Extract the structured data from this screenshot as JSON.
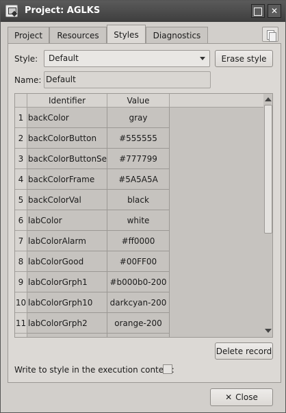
{
  "window": {
    "title": "Project: AGLKS"
  },
  "tabs": [
    {
      "label": "Project",
      "active": false
    },
    {
      "label": "Resources",
      "active": false
    },
    {
      "label": "Styles",
      "active": true
    },
    {
      "label": "Diagnostics",
      "active": false
    }
  ],
  "style_row": {
    "label": "Style:",
    "selected": "Default",
    "erase_label": "Erase style"
  },
  "name_row": {
    "label": "Name:",
    "value": "Default"
  },
  "table": {
    "headers": [
      "Identifier",
      "Value"
    ],
    "rows": [
      {
        "num": "1",
        "id": "backColor",
        "value": "gray"
      },
      {
        "num": "2",
        "id": "backColorButton",
        "value": "#555555"
      },
      {
        "num": "3",
        "id": "backColorButtonSel",
        "value": "#777799"
      },
      {
        "num": "4",
        "id": "backColorFrame",
        "value": "#5A5A5A"
      },
      {
        "num": "5",
        "id": "backColorVal",
        "value": "black"
      },
      {
        "num": "6",
        "id": "labColor",
        "value": "white"
      },
      {
        "num": "7",
        "id": "labColorAlarm",
        "value": "#ff0000"
      },
      {
        "num": "8",
        "id": "labColorGood",
        "value": "#00FF00"
      },
      {
        "num": "9",
        "id": "labColorGrph1",
        "value": "#b000b0-200"
      },
      {
        "num": "10",
        "id": "labColorGrph10",
        "value": "darkcyan-200"
      },
      {
        "num": "11",
        "id": "labColorGrph2",
        "value": "orange-200"
      }
    ]
  },
  "delete_label": "Delete record",
  "write_context": {
    "label": "Write to style in the execution context:",
    "checked": false
  },
  "close_label": "Close",
  "colors": {
    "titlebar": "#4a4a4a",
    "window_bg": "#d2cfcb",
    "table_bg": "#c6c3bf"
  }
}
